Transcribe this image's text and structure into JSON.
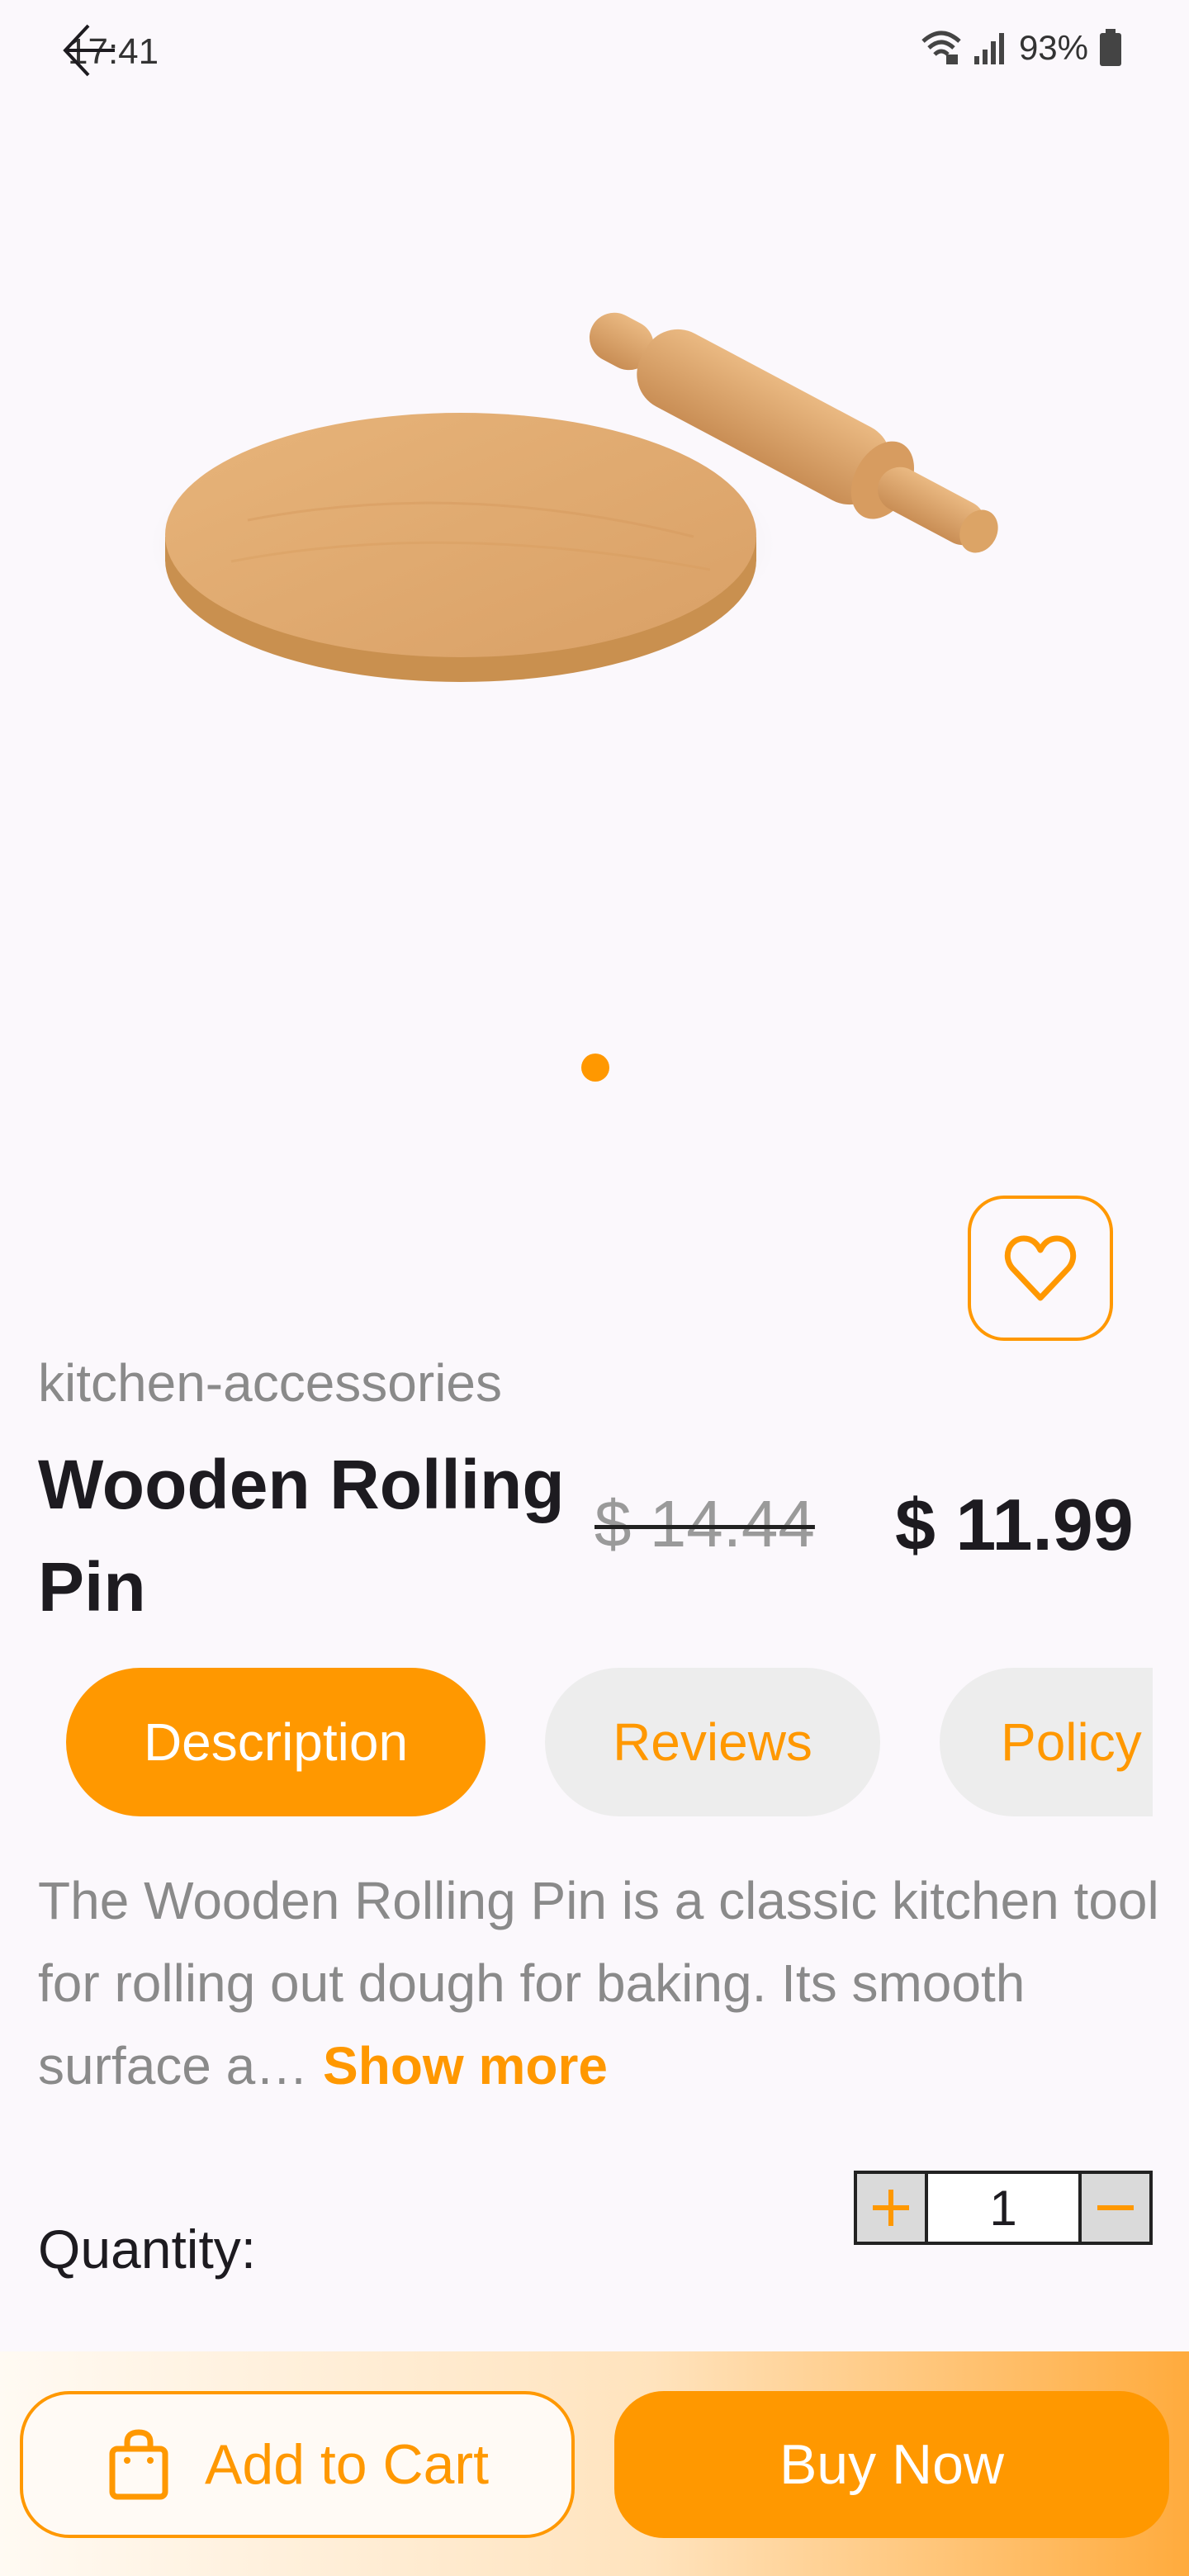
{
  "status_bar": {
    "time": "17:41",
    "battery": "93%"
  },
  "product": {
    "category": "kitchen-accessories",
    "title": "Wooden Rolling Pin",
    "old_price": "$ 14.44",
    "price": "$ 11.99",
    "image_count": 1
  },
  "tabs": [
    {
      "label": "Description",
      "active": true
    },
    {
      "label": "Reviews",
      "active": false
    },
    {
      "label": "Policy",
      "active": false
    }
  ],
  "description": {
    "text": "The Wooden Rolling Pin is a classic kitchen tool for rolling out dough for baking. Its smooth surface a… ",
    "show_more": "Show more"
  },
  "quantity": {
    "label": "Quantity:",
    "value": "1",
    "plus": "+",
    "minus": "–"
  },
  "actions": {
    "add_to_cart": "Add to Cart",
    "buy_now": "Buy Now"
  },
  "colors": {
    "accent": "#ff9800",
    "background": "#fbf8fc"
  },
  "icons": [
    "back-arrow-icon",
    "wifi-icon",
    "signal-icon",
    "battery-icon",
    "heart-icon",
    "shopping-bag-icon"
  ]
}
